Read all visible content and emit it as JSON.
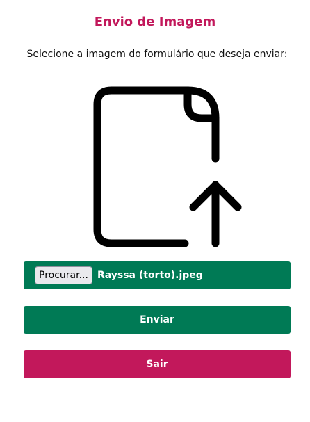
{
  "header": {
    "title": "Envio de Imagem",
    "instruction": "Selecione a imagem do formulário que deseja enviar:"
  },
  "upload": {
    "icon": "file-upload-icon",
    "browse_label": "Procurar...",
    "selected_file": "Rayssa (torto).jpeg"
  },
  "actions": {
    "submit_label": "Enviar",
    "exit_label": "Sair"
  },
  "colors": {
    "accent": "#c2185b",
    "primary": "#007a55",
    "danger": "#c2185b"
  }
}
